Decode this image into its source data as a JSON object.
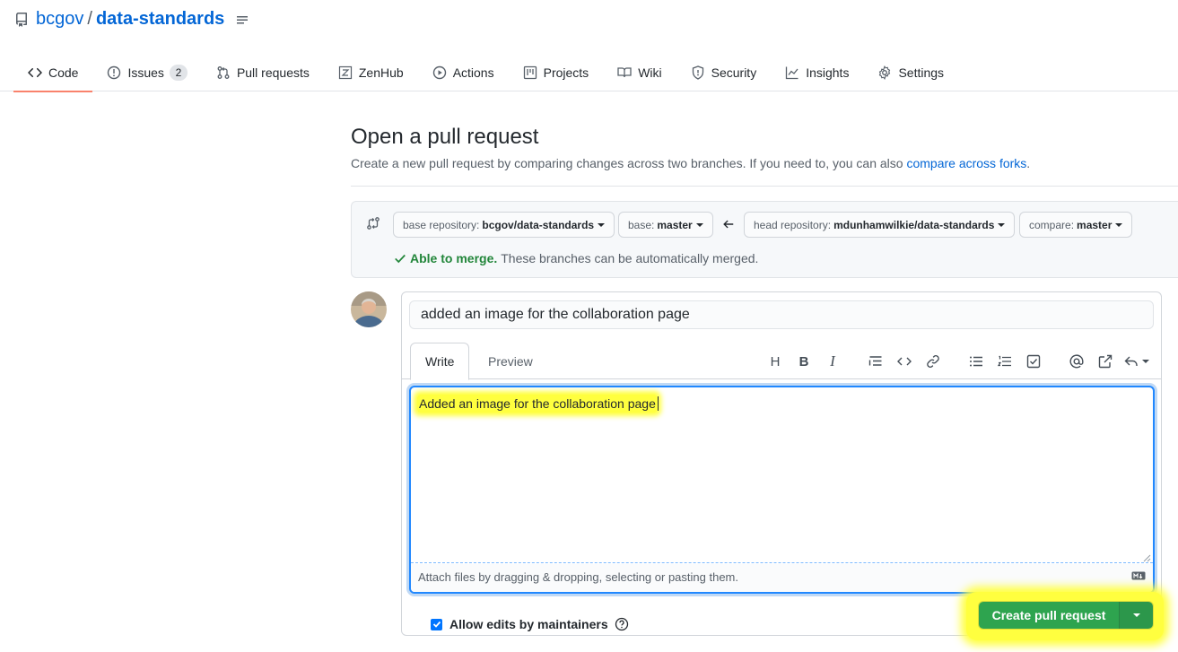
{
  "repo": {
    "owner": "bcgov",
    "separator": "/",
    "name": "data-standards"
  },
  "tabs": [
    {
      "label": "Code",
      "icon": "code-icon"
    },
    {
      "label": "Issues",
      "icon": "issue-icon",
      "count": "2"
    },
    {
      "label": "Pull requests",
      "icon": "pull-request-icon"
    },
    {
      "label": "ZenHub",
      "icon": "zenhub-icon"
    },
    {
      "label": "Actions",
      "icon": "play-icon"
    },
    {
      "label": "Projects",
      "icon": "project-icon"
    },
    {
      "label": "Wiki",
      "icon": "book-icon"
    },
    {
      "label": "Security",
      "icon": "shield-icon"
    },
    {
      "label": "Insights",
      "icon": "graph-icon"
    },
    {
      "label": "Settings",
      "icon": "gear-icon"
    }
  ],
  "page": {
    "title": "Open a pull request",
    "subtitle": "Create a new pull request by comparing changes across two branches. If you need to, you can also",
    "subtitle_link": "compare across forks",
    "subtitle_end": "."
  },
  "range": {
    "base_repo_label": "base repository:",
    "base_repo_value": "bcgov/data-standards",
    "base_label": "base:",
    "base_value": "master",
    "head_repo_label": "head repository:",
    "head_repo_value": "mdunhamwilkie/data-standards",
    "compare_label": "compare:",
    "compare_value": "master",
    "merge_ok": "Able to merge.",
    "merge_text": "These branches can be automatically merged."
  },
  "composer": {
    "title_value": "added an image for the collaboration page",
    "tab_write": "Write",
    "tab_preview": "Preview",
    "toolbar": {
      "heading": "H",
      "bold": "B",
      "italic": "I"
    },
    "body_value": "Added an image for the collaboration page",
    "attach_text": "Attach files by dragging & dropping, selecting or pasting them."
  },
  "footer": {
    "allow_edits": "Allow edits by maintainers",
    "create_label": "Create pull request"
  },
  "colors": {
    "link": "#0366d6",
    "primary_button": "#2ea44f",
    "highlight": "#ffff3f",
    "success_text": "#22863a",
    "selected_tab_underline": "#f9826c"
  }
}
